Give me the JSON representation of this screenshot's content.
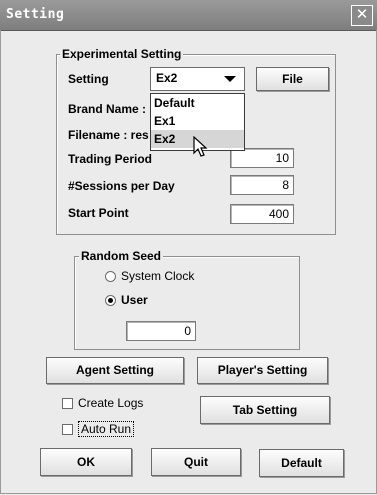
{
  "window": {
    "title": "Setting",
    "close_label": "✕"
  },
  "experimental": {
    "legend": "Experimental Setting",
    "setting_label": "Setting",
    "setting_value": "Ex2",
    "file_button": "File",
    "brand_label": "Brand Name :",
    "filename_label": "Filename : res",
    "trading_label": "Trading Period",
    "trading_value": "10",
    "sessions_label": "#Sessions per Day",
    "sessions_value": "8",
    "start_label": "Start Point",
    "start_value": "400",
    "dropdown_options": [
      "Default",
      "Ex1",
      "Ex2"
    ]
  },
  "random_seed": {
    "legend": "Random Seed",
    "system_clock_label": "System Clock",
    "user_label": "User",
    "user_value": "0"
  },
  "buttons": {
    "agent_setting": "Agent Setting",
    "player_setting": "Player's Setting",
    "tab_setting": "Tab Setting",
    "ok": "OK",
    "quit": "Quit",
    "default": "Default"
  },
  "checkboxes": {
    "create_logs": "Create Logs",
    "auto_run": "Auto Run"
  }
}
